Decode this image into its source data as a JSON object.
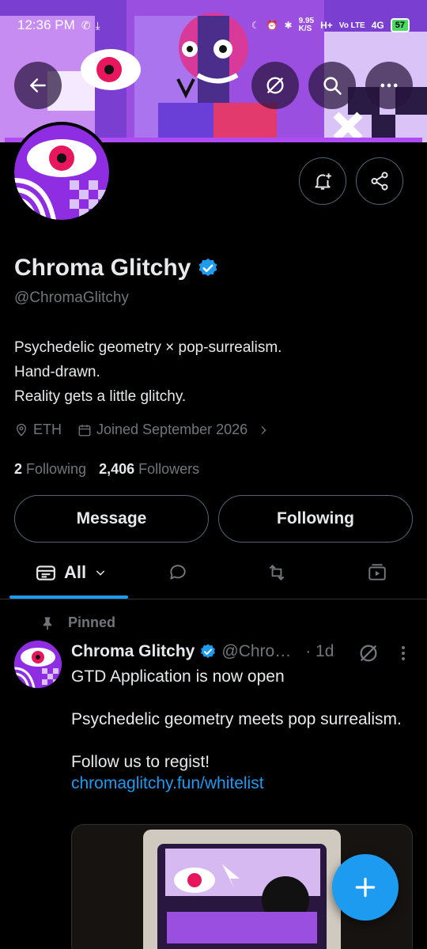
{
  "status_bar": {
    "time": "12:36 PM",
    "net_speed": "9.95",
    "net_unit": "K/S",
    "net_type_1": "H+",
    "net_type_2": "Vo LTE",
    "net_type_3": "4G",
    "battery": "57"
  },
  "header": {
    "back_icon": "arrow-left-icon",
    "grok_icon": "grok-icon",
    "search_icon": "search-icon",
    "more_icon": "more-horizontal-icon"
  },
  "profile": {
    "name": "Chroma Glitchy",
    "verified": true,
    "handle": "@ChromaGlitchy",
    "bio_lines": [
      "Psychedelic geometry × pop-surrealism.",
      "Hand-drawn.",
      "Reality gets a little glitchy."
    ],
    "location": "ETH",
    "joined": "Joined September 2026",
    "following_count": "2",
    "following_label": "Following",
    "followers_count": "2,406",
    "followers_label": "Followers"
  },
  "actions": {
    "notify_icon": "bell-plus-icon",
    "share_icon": "share-icon",
    "message_label": "Message",
    "following_label": "Following"
  },
  "tabs": {
    "all_label": "All",
    "items": [
      "all",
      "replies",
      "reposts",
      "media"
    ]
  },
  "pinned_post": {
    "pinned_label": "Pinned",
    "author_name": "Chroma Glitchy",
    "author_handle": "@Chro…",
    "time": "· 1d",
    "line1": "GTD Application is now open",
    "line2": "Psychedelic geometry meets pop surrealism.",
    "line3": "Follow us to regist!",
    "link": "chromaglitchy.fun/whitelist"
  },
  "colors": {
    "accent": "#1d9bf0",
    "banner_purple": "#8a3de0",
    "avatar_red": "#e8175d"
  }
}
